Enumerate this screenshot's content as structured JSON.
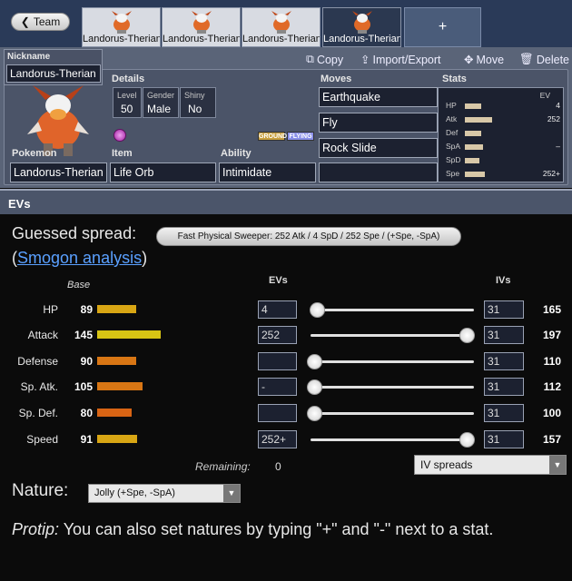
{
  "team_button": {
    "label": "Team",
    "icon": "chevron-left-icon"
  },
  "team_tabs": [
    {
      "label": "Landorus-Therian"
    },
    {
      "label": "Landorus-Therian"
    },
    {
      "label": "Landorus-Therian"
    },
    {
      "label": "Landorus-Therian"
    }
  ],
  "add_tab": "+",
  "actions": {
    "copy": "Copy",
    "import_export": "Import/Export",
    "move": "Move",
    "delete": "Delete"
  },
  "nickname": {
    "label": "Nickname",
    "value": "Landorus-Therian"
  },
  "details": {
    "label": "Details",
    "level_cap": "Level",
    "level": "50",
    "gender_cap": "Gender",
    "gender": "Male",
    "shiny_cap": "Shiny",
    "shiny": "No"
  },
  "types": [
    "GROUND",
    "FLYING"
  ],
  "moves": {
    "label": "Moves",
    "list": [
      "Earthquake",
      "Fly",
      "Rock Slide",
      ""
    ]
  },
  "pokemon": {
    "label": "Pokemon",
    "value": "Landorus-Therian"
  },
  "item": {
    "label": "Item",
    "value": "Life Orb"
  },
  "ability": {
    "label": "Ability",
    "value": "Intimidate"
  },
  "stats_summary": {
    "label": "Stats",
    "ev_header": "EV",
    "rows": [
      {
        "name": "HP",
        "ev": "4",
        "bar": 0.45
      },
      {
        "name": "Atk",
        "ev": "252",
        "bar": 0.75
      },
      {
        "name": "Def",
        "ev": "",
        "bar": 0.45
      },
      {
        "name": "SpA",
        "ev": "–",
        "bar": 0.5
      },
      {
        "name": "SpD",
        "ev": "",
        "bar": 0.4
      },
      {
        "name": "Spe",
        "ev": "252+",
        "bar": 0.55
      }
    ]
  },
  "evs_section": {
    "title": "EVs",
    "guessed_label": "Guessed spread:",
    "guessed_value": "Fast Physical Sweeper: 252 Atk / 4 SpD / 252 Spe / (+Spe, -SpA)",
    "smogon_prefix": "(",
    "smogon_link": "Smogon analysis",
    "smogon_suffix": ")",
    "headers": {
      "base": "Base",
      "evs": "EVs",
      "ivs": "IVs"
    },
    "rows": [
      {
        "name": "HP",
        "base": "89",
        "base_num": 89,
        "ev": "4",
        "ev_num": 4,
        "iv": "31",
        "total": "165",
        "color": "#d8a614"
      },
      {
        "name": "Attack",
        "base": "145",
        "base_num": 145,
        "ev": "252",
        "ev_num": 252,
        "iv": "31",
        "total": "197",
        "color": "#d8c414"
      },
      {
        "name": "Defense",
        "base": "90",
        "base_num": 90,
        "ev": "",
        "ev_num": 0,
        "iv": "31",
        "total": "110",
        "color": "#d87614"
      },
      {
        "name": "Sp. Atk.",
        "base": "105",
        "base_num": 105,
        "ev": "-",
        "ev_num": 0,
        "iv": "31",
        "total": "112",
        "color": "#d87614"
      },
      {
        "name": "Sp. Def.",
        "base": "80",
        "base_num": 80,
        "ev": "",
        "ev_num": 0,
        "iv": "31",
        "total": "100",
        "color": "#d86414"
      },
      {
        "name": "Speed",
        "base": "91",
        "base_num": 91,
        "ev": "252+",
        "ev_num": 252,
        "iv": "31",
        "total": "157",
        "color": "#d8a614"
      }
    ],
    "remaining_label": "Remaining:",
    "remaining_value": "0",
    "iv_spreads": "IV spreads",
    "nature_label": "Nature:",
    "nature_value": "Jolly (+Spe, -SpA)",
    "protip_em": "Protip:",
    "protip_text": " You can also set natures by typing \"+\" and \"-\" next to a stat."
  },
  "colors": {
    "ground_type": "#c8a040",
    "flying_type": "#8a90e8",
    "link": "#5aa0ff"
  }
}
